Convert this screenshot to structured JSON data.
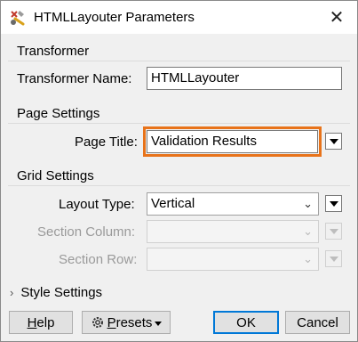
{
  "window": {
    "title": "HTMLLayouter Parameters"
  },
  "transformer": {
    "section_title": "Transformer",
    "name_label": "Transformer Name:",
    "name_value": "HTMLLayouter"
  },
  "page_settings": {
    "section_title": "Page Settings",
    "title_label": "Page Title:",
    "title_value": "Validation Results",
    "highlight_color": "#e8731a"
  },
  "grid_settings": {
    "section_title": "Grid Settings",
    "layout_type_label": "Layout Type:",
    "layout_type_value": "Vertical",
    "section_column_label": "Section Column:",
    "section_column_value": "",
    "section_row_label": "Section Row:",
    "section_row_value": ""
  },
  "style_settings": {
    "label": "Style Settings",
    "expanded": false
  },
  "footer": {
    "help_prefix": "",
    "help_mnemonic": "H",
    "help_rest": "elp",
    "presets_mnemonic": "P",
    "presets_rest": "resets",
    "ok_label": "OK",
    "cancel_label": "Cancel"
  }
}
